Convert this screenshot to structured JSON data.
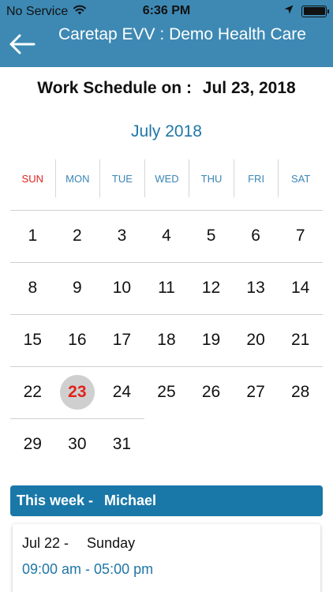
{
  "status_bar": {
    "carrier": "No Service",
    "time": "6:36 PM",
    "wifi_icon": "wifi-icon",
    "location_icon": "location-arrow-icon",
    "battery_icon": "battery-icon"
  },
  "nav": {
    "back_icon": "arrow-left-icon",
    "title": "Caretap EVV : Demo Health Care"
  },
  "schedule": {
    "label": "Work Schedule on :",
    "date": "Jul 23, 2018"
  },
  "calendar": {
    "month_title": "July 2018",
    "weekdays": [
      "SUN",
      "MON",
      "TUE",
      "WED",
      "THU",
      "FRI",
      "SAT"
    ],
    "weeks": [
      [
        "1",
        "2",
        "3",
        "4",
        "5",
        "6",
        "7"
      ],
      [
        "8",
        "9",
        "10",
        "11",
        "12",
        "13",
        "14"
      ],
      [
        "15",
        "16",
        "17",
        "18",
        "19",
        "20",
        "21"
      ],
      [
        "22",
        "23",
        "24",
        "25",
        "26",
        "27",
        "28"
      ],
      [
        "29",
        "30",
        "31"
      ]
    ],
    "selected_day": "23"
  },
  "week_panel": {
    "label": "This week -",
    "name": "Michael"
  },
  "entries": [
    {
      "date": "Jul 22 -",
      "weekday": "Sunday",
      "time_range": "09:00 am - 05:00 pm"
    }
  ],
  "colors": {
    "header_bg": "#3d89b4",
    "accent": "#1f76a6",
    "week_bar_bg": "#1a78a8",
    "sunday_red": "#e0231c",
    "selected_bg": "#cfcfcf"
  }
}
